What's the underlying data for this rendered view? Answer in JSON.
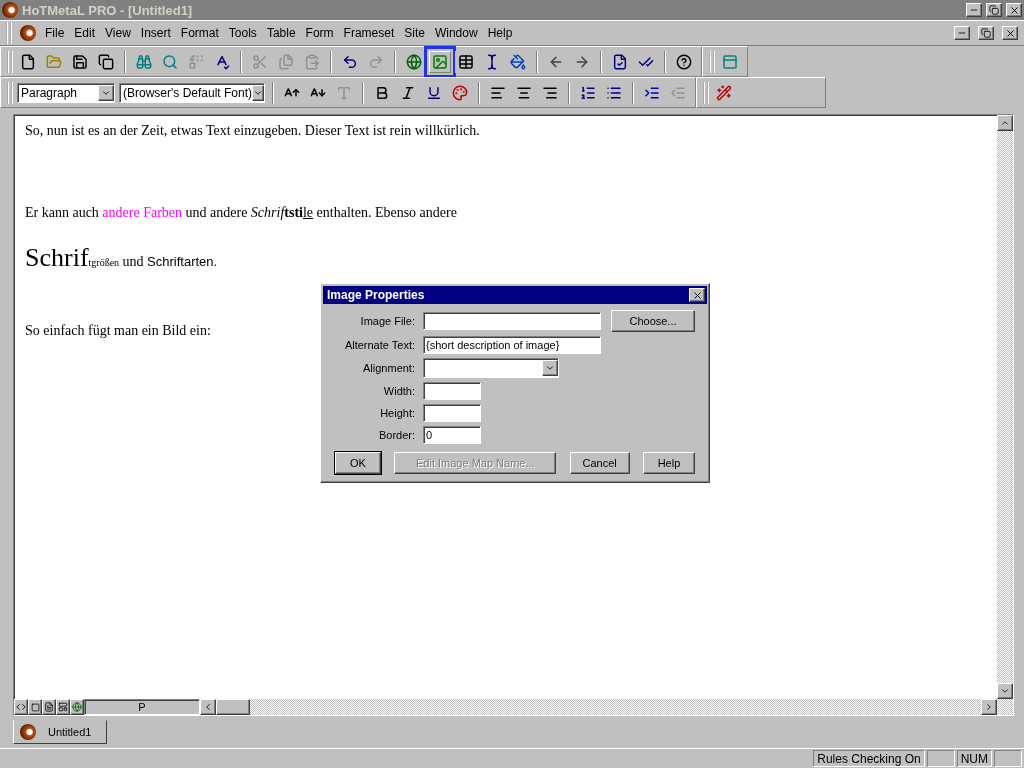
{
  "window": {
    "title": "HoTMetaL PRO - [Untitled1]"
  },
  "menu": [
    "File",
    "Edit",
    "View",
    "Insert",
    "Format",
    "Tools",
    "Table",
    "Form",
    "Frameset",
    "Site",
    "Window",
    "Help"
  ],
  "toolbar_main": [
    {
      "kind": "new",
      "disabled": false,
      "selected": false
    },
    {
      "kind": "open",
      "disabled": false,
      "selected": false
    },
    {
      "kind": "save",
      "disabled": false,
      "selected": false
    },
    {
      "kind": "saveall",
      "disabled": false,
      "selected": false
    },
    {
      "kind": "sep"
    },
    {
      "kind": "find",
      "disabled": false,
      "selected": false
    },
    {
      "kind": "findnext",
      "disabled": false,
      "selected": false
    },
    {
      "kind": "replace",
      "disabled": true,
      "selected": false
    },
    {
      "kind": "spell",
      "disabled": false,
      "selected": false
    },
    {
      "kind": "sep"
    },
    {
      "kind": "cut",
      "disabled": true,
      "selected": false
    },
    {
      "kind": "copy",
      "disabled": true,
      "selected": false
    },
    {
      "kind": "paste",
      "disabled": true,
      "selected": false
    },
    {
      "kind": "sep"
    },
    {
      "kind": "undo",
      "disabled": false,
      "selected": false
    },
    {
      "kind": "redo",
      "disabled": true,
      "selected": false
    },
    {
      "kind": "sep"
    },
    {
      "kind": "link",
      "disabled": false,
      "selected": false
    },
    {
      "kind": "image",
      "disabled": false,
      "selected": true
    },
    {
      "kind": "table",
      "disabled": false,
      "selected": false
    },
    {
      "kind": "cursor",
      "disabled": false,
      "selected": false
    },
    {
      "kind": "paint",
      "disabled": false,
      "selected": false
    },
    {
      "kind": "sep"
    },
    {
      "kind": "back",
      "disabled": false,
      "selected": false
    },
    {
      "kind": "forward",
      "disabled": false,
      "selected": false
    },
    {
      "kind": "sep"
    },
    {
      "kind": "validate",
      "disabled": false,
      "selected": false
    },
    {
      "kind": "check",
      "disabled": false,
      "selected": false
    },
    {
      "kind": "sep"
    },
    {
      "kind": "help",
      "disabled": false,
      "selected": false
    }
  ],
  "toolbar_side": [
    {
      "kind": "panel",
      "disabled": false,
      "selected": false
    }
  ],
  "format_bar": {
    "style": "Paragraph",
    "font": "(Browser's Default Font)",
    "buttons": [
      {
        "kind": "grow",
        "disabled": false,
        "selected": false
      },
      {
        "kind": "shrink",
        "disabled": false,
        "selected": false
      },
      {
        "kind": "fontprops",
        "disabled": true,
        "selected": false
      },
      {
        "kind": "sep"
      },
      {
        "kind": "bold",
        "disabled": false,
        "selected": false
      },
      {
        "kind": "italic",
        "disabled": false,
        "selected": false
      },
      {
        "kind": "underline",
        "disabled": false,
        "selected": false
      },
      {
        "kind": "color",
        "disabled": false,
        "selected": false
      },
      {
        "kind": "sep"
      },
      {
        "kind": "left",
        "disabled": false,
        "selected": false
      },
      {
        "kind": "center",
        "disabled": false,
        "selected": false
      },
      {
        "kind": "right",
        "disabled": false,
        "selected": false
      },
      {
        "kind": "sep"
      },
      {
        "kind": "ol",
        "disabled": false,
        "selected": false
      },
      {
        "kind": "ul",
        "disabled": false,
        "selected": false
      },
      {
        "kind": "sep"
      },
      {
        "kind": "indent",
        "disabled": false,
        "selected": false
      },
      {
        "kind": "outdent",
        "disabled": true,
        "selected": false
      }
    ],
    "extra": [
      {
        "kind": "macro",
        "disabled": false,
        "selected": false
      }
    ]
  },
  "document": {
    "paragraphs": [
      [
        {
          "kind": "plain",
          "text": "So, nun ist es an der Zeit, etwas Text einzugeben. Dieser Text ist rein willkürlich."
        }
      ],
      [
        {
          "kind": "plain",
          "text": "Er kann auch "
        },
        {
          "kind": "colored",
          "color": "#ff00ff",
          "text": "andere Farben"
        },
        {
          "kind": "plain",
          "text": " und andere "
        },
        {
          "kind": "italic",
          "text": "Schrif"
        },
        {
          "kind": "bold",
          "text": "tsti"
        },
        {
          "kind": "underline",
          "text": "le"
        },
        {
          "kind": "plain",
          "text": " enthalten. Ebenso andere"
        }
      ],
      [
        {
          "kind": "large",
          "text": "Schrif"
        },
        {
          "kind": "small",
          "text": "tgrößen"
        },
        {
          "kind": "plain",
          "text": " und "
        },
        {
          "kind": "sans",
          "text": "Schriftarten."
        }
      ],
      [
        {
          "kind": "plain",
          "text": "So einfach fügt man ein Bild ein:"
        }
      ]
    ],
    "element": "P"
  },
  "dialog": {
    "title": "Image Properties",
    "fields": [
      {
        "kind": "text",
        "label": "Image File:"
      },
      {
        "kind": "text",
        "label": "Alternate Text:",
        "value": "{short description of image}"
      },
      {
        "kind": "select",
        "label": "Alignment:"
      },
      {
        "kind": "short",
        "label": "Width:"
      },
      {
        "kind": "short",
        "label": "Height:"
      },
      {
        "kind": "short",
        "label": "Border:",
        "value": "0"
      }
    ],
    "choose": "Choose...",
    "buttons": [
      {
        "label": "OK",
        "disabled": false,
        "default": true
      },
      {
        "label": "Edit Image Map Name...",
        "disabled": true,
        "default": false
      },
      {
        "label": "Cancel",
        "disabled": false,
        "default": false
      },
      {
        "label": "Help",
        "disabled": false,
        "default": false
      }
    ]
  },
  "tabs": [
    {
      "label": "Untitled1",
      "selected": true
    }
  ],
  "status_bar": [
    "Rules Checking On",
    "NUM"
  ]
}
